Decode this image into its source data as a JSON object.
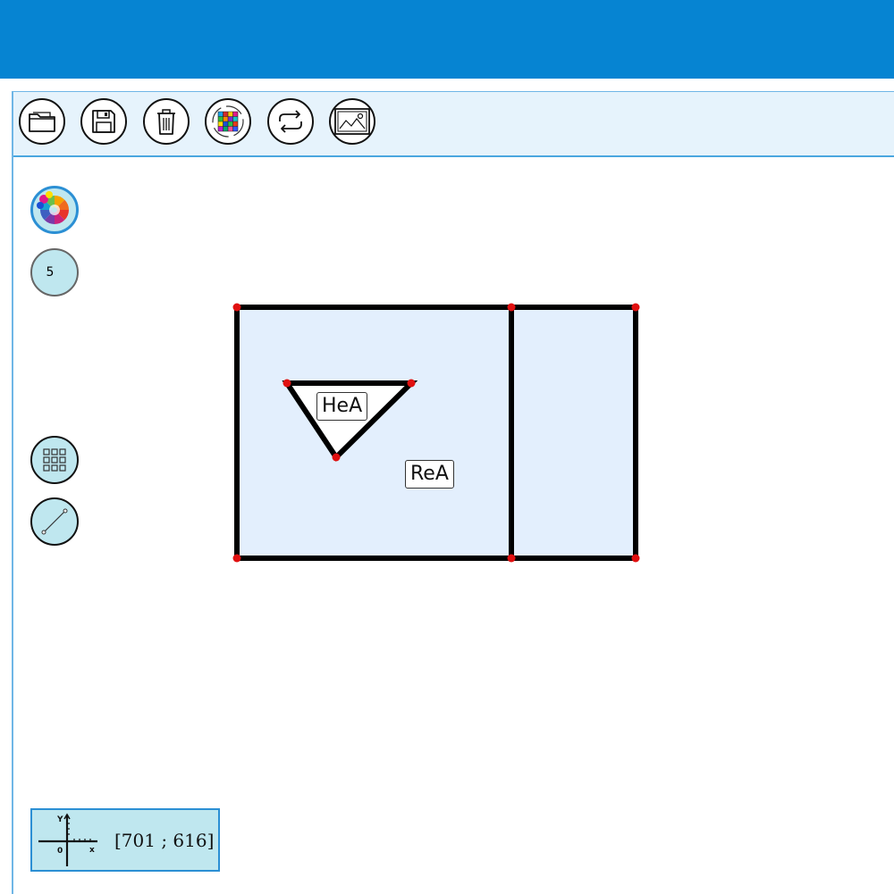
{
  "toolbar": {
    "buttons": [
      {
        "name": "open-folder",
        "icon": "folder-icon"
      },
      {
        "name": "save",
        "icon": "floppy-disk-icon"
      },
      {
        "name": "delete",
        "icon": "trash-icon"
      },
      {
        "name": "color-grid",
        "icon": "color-grid-icon"
      },
      {
        "name": "refresh",
        "icon": "refresh-icon"
      },
      {
        "name": "image",
        "icon": "image-icon"
      }
    ]
  },
  "sidebar": {
    "color_picker_icon": "color-wheel-icon",
    "line_width": "5",
    "grid_icon": "grid-icon",
    "segment_icon": "line-segment-icon"
  },
  "canvas": {
    "labels": {
      "triangle": "HeA",
      "rectangle": "ReA"
    }
  },
  "coordinates": {
    "text": "[701 ; 616]",
    "icon": "axes-icon",
    "axis_x": "x",
    "axis_y": "Y",
    "origin": "0"
  },
  "colors": {
    "header": "#0684d2",
    "toolbar_bg": "#e6f3fc",
    "shape_fill": "#e3effd",
    "vertex": "#e01010",
    "side_button": "#bfe7ef"
  }
}
